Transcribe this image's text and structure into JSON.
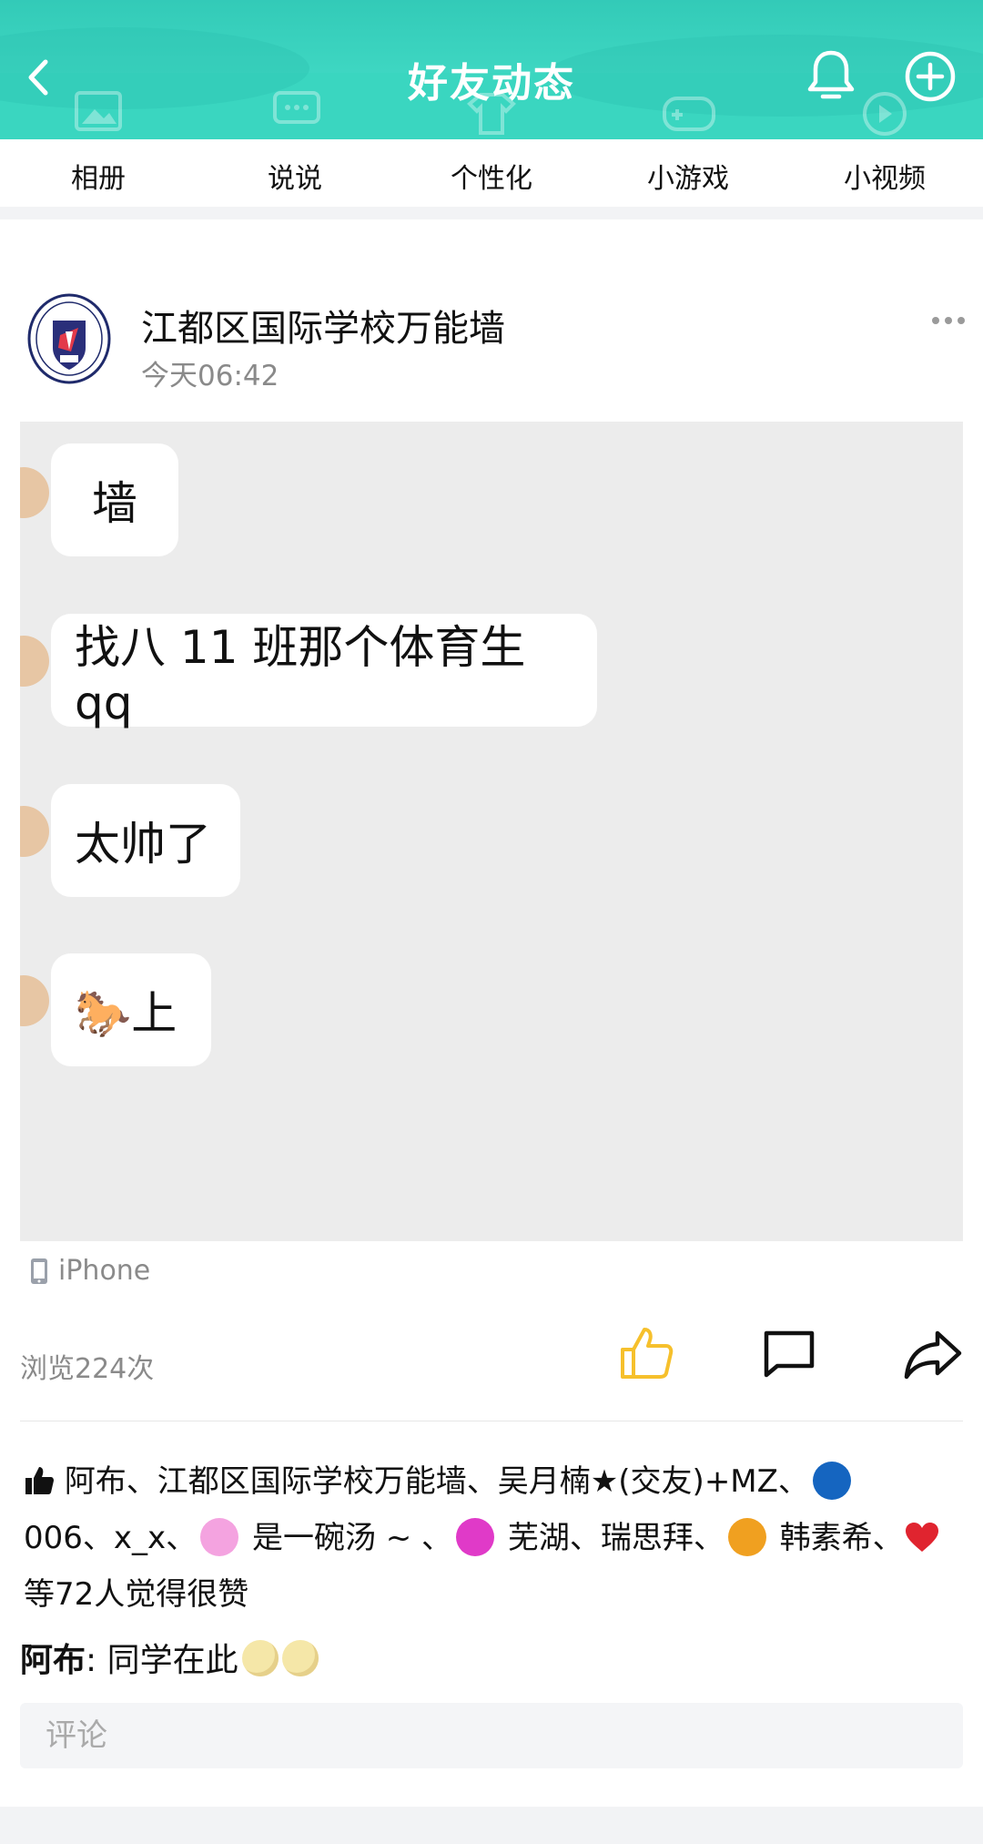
{
  "header": {
    "title": "好友动态",
    "bg_color": "#3ad6c0"
  },
  "tabs": [
    {
      "label": "相册"
    },
    {
      "label": "说说"
    },
    {
      "label": "个性化"
    },
    {
      "label": "小游戏"
    },
    {
      "label": "小视频"
    }
  ],
  "post": {
    "author": "江都区国际学校万能墙",
    "time": "今天06:42",
    "chat_bubbles": [
      {
        "text": "墙"
      },
      {
        "text": "找八 11 班那个体育生 qq"
      },
      {
        "text": "太帅了"
      },
      {
        "text": "🐎上"
      }
    ],
    "device": "iPhone",
    "views": "浏览224次",
    "like_color": "#f6c02c"
  },
  "likes": {
    "line1": "阿布、江都区国际学校万能墙、吴月楠★(交友)+MZ、",
    "line2a": "006、x_x、",
    "line2b": " 是一碗汤 ~ 、",
    "line2c": " 芜湖、瑞思拜、",
    "line2d": " 韩素希、",
    "line3": "等72人觉得很赞"
  },
  "comment": {
    "author": "阿布",
    "text": ": 同学在此"
  },
  "comment_input": {
    "placeholder": "评论"
  }
}
